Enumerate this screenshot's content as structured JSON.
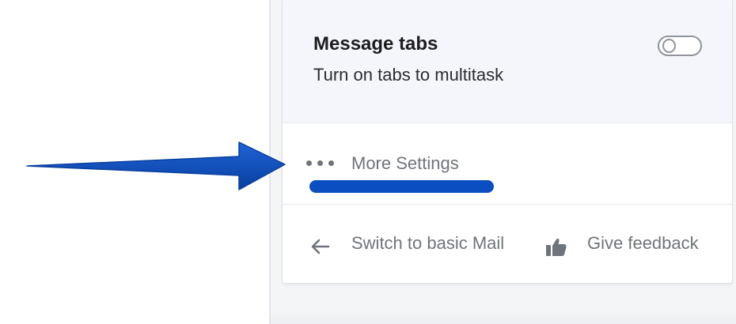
{
  "settings_panel": {
    "message_tabs": {
      "title": "Message tabs",
      "description": "Turn on tabs to multitask",
      "toggle_on": false
    },
    "more_settings": {
      "label": "More Settings",
      "icon": "more-dots-icon"
    },
    "footer": {
      "switch_basic": {
        "label": "Switch to basic Mail",
        "icon": "arrow-left-icon"
      },
      "feedback": {
        "label": "Give feedback",
        "icon": "thumbs-up-icon"
      }
    }
  },
  "annotation": {
    "arrow_color": "#0a4ec2",
    "highlight_color": "#0a4ec2"
  },
  "colors": {
    "panel_header_bg": "#f5f6fb",
    "muted_text": "#6f747c",
    "title_text": "#1d1d1f"
  }
}
